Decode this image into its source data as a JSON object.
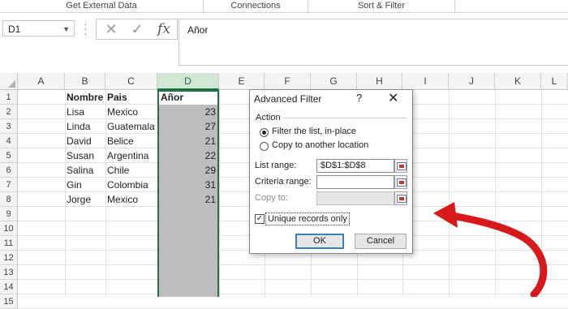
{
  "ribbon": {
    "groups": [
      "Get External Data",
      "Connections",
      "Sort & Filter"
    ]
  },
  "formula_bar": {
    "name_box": "D1",
    "cancel_icon": "✕",
    "enter_icon": "✓",
    "fx_label": "fx",
    "content": "Añor"
  },
  "columns": [
    "A",
    "B",
    "C",
    "D",
    "E",
    "F",
    "G",
    "H",
    "I",
    "J",
    "K",
    "L"
  ],
  "rows": [
    "1",
    "2",
    "3",
    "4",
    "5",
    "6",
    "7",
    "8",
    "9",
    "10",
    "11",
    "12",
    "13",
    "14",
    "15"
  ],
  "table": {
    "headers": [
      "Nombre",
      "Pais",
      "Añor"
    ],
    "records": [
      {
        "nombre": "Lisa",
        "pais": "Mexico",
        "anor": "23"
      },
      {
        "nombre": "Linda",
        "pais": "Guatemala",
        "anor": "27"
      },
      {
        "nombre": "David",
        "pais": "Belice",
        "anor": "21"
      },
      {
        "nombre": "Susan",
        "pais": "Argentina",
        "anor": "22"
      },
      {
        "nombre": "Salina",
        "pais": "Chile",
        "anor": "29"
      },
      {
        "nombre": "Gin",
        "pais": "Colombia",
        "anor": "31"
      },
      {
        "nombre": "Jorge",
        "pais": "Mexico",
        "anor": "21"
      }
    ]
  },
  "dialog": {
    "title": "Advanced Filter",
    "help": "?",
    "close": "✕",
    "action_label": "Action",
    "radio_filter": "Filter the list, in-place",
    "radio_copy": "Copy to another location",
    "list_range_label": "List range:",
    "list_range_value": "$D$1:$D$8",
    "criteria_range_label": "Criteria range:",
    "criteria_range_value": "",
    "copy_to_label": "Copy to:",
    "copy_to_value": "",
    "unique_label": "Unique records only",
    "unique_checked": true,
    "ok": "OK",
    "cancel": "Cancel"
  },
  "colors": {
    "selection_green": "#217346",
    "arrow_red": "#d7191c",
    "selected_range": "#bdbdbd"
  }
}
